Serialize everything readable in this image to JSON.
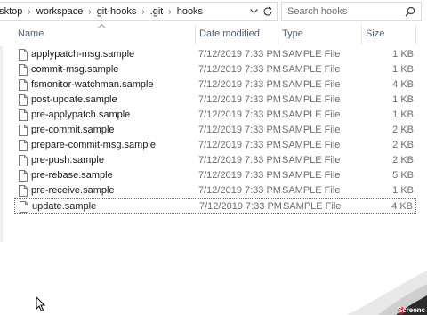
{
  "address": {
    "crumbs": [
      "esktop",
      "workspace",
      "git-hooks",
      ".git",
      "hooks"
    ],
    "separator": "›",
    "dropdown_icon": "chevron-down-icon",
    "refresh_icon": "refresh-icon"
  },
  "search": {
    "placeholder": "Search hooks"
  },
  "columns": {
    "name": "Name",
    "date": "Date modified",
    "type": "Type",
    "size": "Size"
  },
  "files": [
    {
      "name": "applypatch-msg.sample",
      "date": "7/12/2019 7:33 PM",
      "type": "SAMPLE File",
      "size": "1 KB"
    },
    {
      "name": "commit-msg.sample",
      "date": "7/12/2019 7:33 PM",
      "type": "SAMPLE File",
      "size": "1 KB"
    },
    {
      "name": "fsmonitor-watchman.sample",
      "date": "7/12/2019 7:33 PM",
      "type": "SAMPLE File",
      "size": "4 KB"
    },
    {
      "name": "post-update.sample",
      "date": "7/12/2019 7:33 PM",
      "type": "SAMPLE File",
      "size": "1 KB"
    },
    {
      "name": "pre-applypatch.sample",
      "date": "7/12/2019 7:33 PM",
      "type": "SAMPLE File",
      "size": "1 KB"
    },
    {
      "name": "pre-commit.sample",
      "date": "7/12/2019 7:33 PM",
      "type": "SAMPLE File",
      "size": "2 KB"
    },
    {
      "name": "prepare-commit-msg.sample",
      "date": "7/12/2019 7:33 PM",
      "type": "SAMPLE File",
      "size": "2 KB"
    },
    {
      "name": "pre-push.sample",
      "date": "7/12/2019 7:33 PM",
      "type": "SAMPLE File",
      "size": "2 KB"
    },
    {
      "name": "pre-rebase.sample",
      "date": "7/12/2019 7:33 PM",
      "type": "SAMPLE File",
      "size": "5 KB"
    },
    {
      "name": "pre-receive.sample",
      "date": "7/12/2019 7:33 PM",
      "type": "SAMPLE File",
      "size": "1 KB"
    },
    {
      "name": "update.sample",
      "date": "7/12/2019 7:33 PM",
      "type": "SAMPLE File",
      "size": "4 KB"
    }
  ],
  "focused_index": 10,
  "watermark": {
    "text": "Screenc"
  },
  "colors": {
    "header_text": "#4c607a",
    "secondary_text": "#6d6d6d",
    "border": "#d9d9d9"
  }
}
